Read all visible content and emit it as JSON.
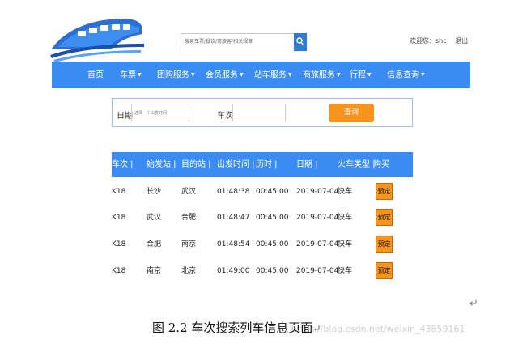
{
  "header": {
    "search_placeholder": "搜索车票/餐饮/常旅客/相关规章",
    "greeting": "欢迎您：shc",
    "logout": "退出"
  },
  "nav": [
    {
      "label": "首页",
      "caret": ""
    },
    {
      "label": "车票",
      "caret": "▼"
    },
    {
      "label": "团购服务",
      "caret": "▼"
    },
    {
      "label": "会员服务",
      "caret": "▼"
    },
    {
      "label": "站车服务",
      "caret": "▼"
    },
    {
      "label": "商旅服务",
      "caret": "▼"
    },
    {
      "label": "行程",
      "caret": "▼"
    },
    {
      "label": "信息查询",
      "caret": "▼"
    }
  ],
  "search_panel": {
    "date_label": "日期",
    "date_placeholder": "选择一个出发时间",
    "train_label": "车次",
    "train_value": "",
    "query_button": "查询"
  },
  "table": {
    "headers": [
      "车次 |",
      "始发站 |",
      "目的站 |",
      "出发时间 |",
      "历时 |",
      "日期 |",
      "火车类型 |",
      "购买"
    ],
    "rows": [
      {
        "train": "K18",
        "from": "长沙",
        "to": "武汉",
        "depart": "01:48:38",
        "duration": "00:45:00",
        "date": "2019-07-04",
        "type": "快车",
        "action": "预定"
      },
      {
        "train": "K18",
        "from": "武汉",
        "to": "合肥",
        "depart": "01:48:47",
        "duration": "00:45:00",
        "date": "2019-07-04",
        "type": "快车",
        "action": "预定"
      },
      {
        "train": "K18",
        "from": "合肥",
        "to": "南京",
        "depart": "01:48:54",
        "duration": "00:45:00",
        "date": "2019-07-04",
        "type": "快车",
        "action": "预定"
      },
      {
        "train": "K18",
        "from": "南京",
        "to": "北京",
        "depart": "01:49:00",
        "duration": "00:45:00",
        "date": "2019-07-04",
        "type": "快车",
        "action": "预定"
      }
    ]
  },
  "caption": {
    "text": "图 2.2  车次搜索列车信息页面",
    "return_mark": "↵"
  },
  "watermark": "https://blog.csdn.net/weixin_43859161",
  "colors": {
    "nav_blue": "#3b8cf2",
    "button_orange": "#f7941d",
    "search_blue": "#2f7bd6"
  },
  "icons": [
    "train-logo-icon",
    "search-icon"
  ]
}
